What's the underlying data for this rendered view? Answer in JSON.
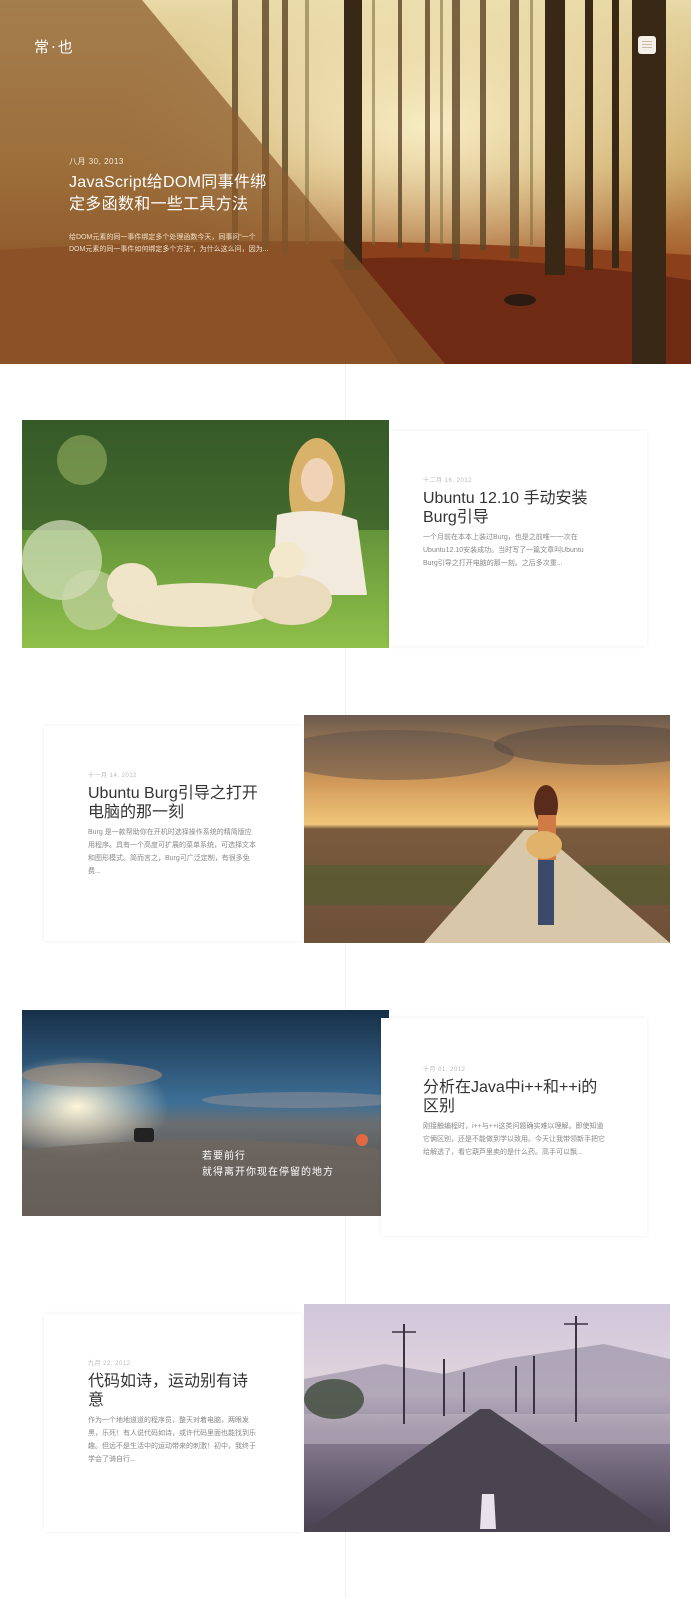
{
  "site": {
    "logo": "常·也"
  },
  "colors": {
    "overlay": "#8a5a2c",
    "title": "#333333",
    "date": "#b9b9b9",
    "excerpt": "#888888"
  },
  "icons": {
    "menu": "hamburger-menu-icon"
  },
  "hero": {
    "date": "八月 30, 2013",
    "title": "JavaScript给DOM同事件绑定多函数和一些工具方法",
    "excerpt": "给DOM元素的同一事件绑定多个处理函数今天，同事问“一个DOM元素的同一事件如何绑定多个方法”，为什么这么问，因为..."
  },
  "posts": [
    {
      "date": "十二月 16, 2012",
      "title": "Ubuntu 12.10 手动安装Burg引导",
      "excerpt": "一个月前在本本上装过Burg，也是之前唯一一次在Ubuntu12.10安装成功。当时写了一篇文章叫Ubuntu Burg引导之打开电脑的那一刻。之后多次重..."
    },
    {
      "date": "十一月 14, 2012",
      "title": "Ubuntu Burg引导之打开电脑的那一刻",
      "excerpt": "Burg 是一款帮助你在开机时选择操作系统的精简版应用程序。具有一个高度可扩展的菜单系统，可选择文本和图形模式。简而言之，Burg可广泛定制，有很多免费..."
    },
    {
      "date": "十月 01, 2012",
      "title": "分析在Java中i++和++i的区别",
      "excerpt": "刚接触编程时，i++与++i这类问题确实难以理解。即使知道它俩区别，还是不能做到学以致用。今天让我带领新手把它给解透了，看它葫芦里卖的是什么药。高手可以飘..."
    },
    {
      "date": "九月 22, 2012",
      "title": "代码如诗，运动别有诗意",
      "excerpt": "作为一个地地道道的程序员，整天对着电脑，两眼发黑，乐死！有人说代码如诗，或许代码里面也能找到乐趣。但远不是生活中的运动带来的刺激！初中，我终于学会了骑自行..."
    }
  ],
  "image_quote": {
    "line1": "若要前行",
    "line2": "就得离开你现在停留的地方"
  }
}
